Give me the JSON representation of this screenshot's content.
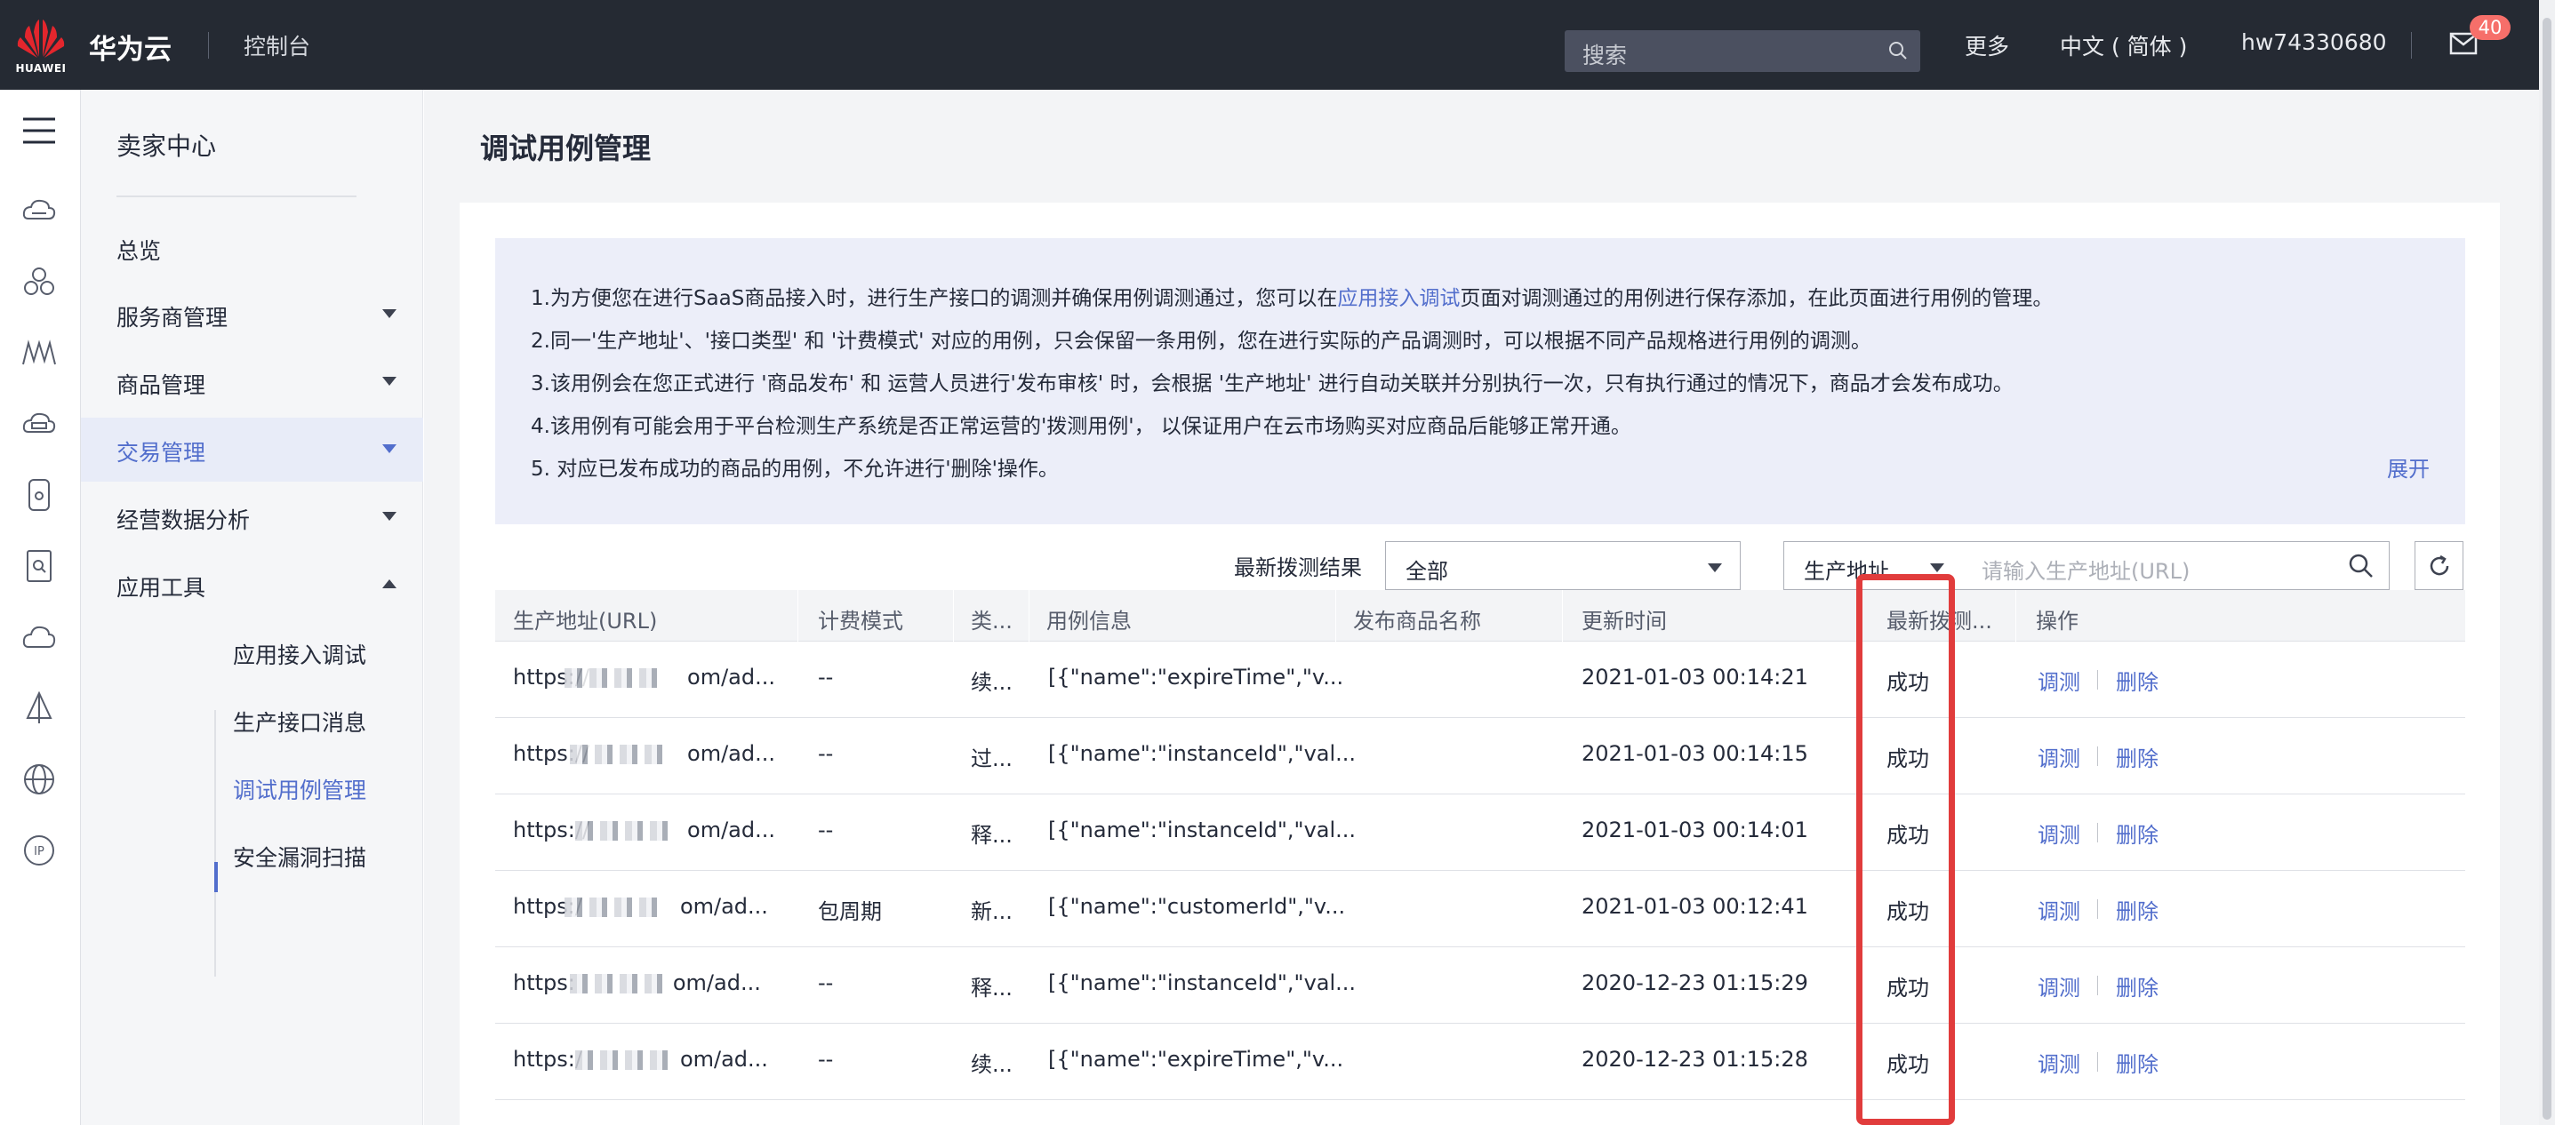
{
  "topbar": {
    "logo_text": "HUAWEI",
    "brand": "华为云",
    "console": "控制台",
    "search_placeholder": "搜索",
    "more": "更多",
    "language": "中文 ( 简体 )",
    "username": "hw74330680",
    "mail_badge": "40"
  },
  "rail": {
    "icons": [
      "menu-icon",
      "cloud-server-icon",
      "cluster-icon",
      "network-icon",
      "storage-icon",
      "mobile-icon",
      "document-search-icon",
      "cloud-icon",
      "sail-icon",
      "globe-icon",
      "ip-icon"
    ]
  },
  "sidemenu": {
    "title": "卖家中心",
    "items": [
      {
        "label": "总览"
      },
      {
        "label": "服务商管理"
      },
      {
        "label": "商品管理"
      },
      {
        "label": "交易管理"
      },
      {
        "label": "经营数据分析"
      },
      {
        "label": "应用工具"
      }
    ],
    "subitems": [
      {
        "label": "应用接入调试"
      },
      {
        "label": "生产接口消息"
      },
      {
        "label": "调试用例管理"
      },
      {
        "label": "安全漏洞扫描"
      }
    ]
  },
  "page": {
    "title": "调试用例管理",
    "notice": {
      "line1_pre": "1.为方便您在进行SaaS商品接入时，进行生产接口的调测并确保用例调测通过，您可以在",
      "line1_link": "应用接入调试",
      "line1_post": "页面对调测通过的用例进行保存添加，在此页面进行用例的管理。",
      "line2": "2.同一'生产地址'、'接口类型' 和 '计费模式' 对应的用例，只会保留一条用例，您在进行实际的产品调测时，可以根据不同产品规格进行用例的调测。",
      "line3": "3.该用例会在您正式进行 '商品发布' 和 运营人员进行'发布审核' 时，会根据 '生产地址' 进行自动关联并分别执行一次，只有执行通过的情况下，商品才会发布成功。",
      "line4": "4.该用例有可能会用于平台检测生产系统是否正常运营的'拨测用例'， 以保证用户在云市场购买对应商品后能够正常开通。",
      "line5": "5. 对应已发布成功的商品的用例，不允许进行'删除'操作。",
      "expand": "展开"
    },
    "filter": {
      "label": "最新拨测结果",
      "result_value": "全部",
      "field_value": "生产地址",
      "url_placeholder": "请输入生产地址(URL)"
    },
    "table": {
      "headers": [
        "生产地址(URL)",
        "计费模式",
        "类...",
        "用例信息",
        "发布商品名称",
        "更新时间",
        "最新拨测...",
        "操作"
      ],
      "rows": [
        {
          "url_start": "https://",
          "url_end": "om/ad...",
          "billing": "--",
          "type": "续...",
          "info": "[{\"name\":\"expireTime\",\"v...",
          "product": "",
          "time": "2021-01-03 00:14:21",
          "result": "成功",
          "debug": "调测",
          "delete": "删除"
        },
        {
          "url_start": "https://",
          "url_end": "om/ad...",
          "billing": "--",
          "type": "过...",
          "info": "[{\"name\":\"instanceId\",\"val...",
          "product": "",
          "time": "2021-01-03 00:14:15",
          "result": "成功",
          "debug": "调测",
          "delete": "删除"
        },
        {
          "url_start": "https://",
          "url_end": "om/ad...",
          "billing": "--",
          "type": "释...",
          "info": "[{\"name\":\"instanceId\",\"val...",
          "product": "",
          "time": "2021-01-03 00:14:01",
          "result": "成功",
          "debug": "调测",
          "delete": "删除"
        },
        {
          "url_start": "https:/",
          "url_end": "om/ad...",
          "billing": "包周期",
          "type": "新...",
          "info": "[{\"name\":\"customerId\",\"v...",
          "product": "",
          "time": "2021-01-03 00:12:41",
          "result": "成功",
          "debug": "调测",
          "delete": "删除"
        },
        {
          "url_start": "https:",
          "url_end": "om/ad...",
          "billing": "--",
          "type": "释...",
          "info": "[{\"name\":\"instanceId\",\"val...",
          "product": "",
          "time": "2020-12-23 01:15:29",
          "result": "成功",
          "debug": "调测",
          "delete": "删除"
        },
        {
          "url_start": "https:/",
          "url_end": "om/ad...",
          "billing": "--",
          "type": "续...",
          "info": "[{\"name\":\"expireTime\",\"v...",
          "product": "",
          "time": "2020-12-23 01:15:28",
          "result": "成功",
          "debug": "调测",
          "delete": "删除"
        }
      ]
    }
  },
  "colors": {
    "topbar": "#252a33",
    "accent": "#526ecc",
    "highlight": "#e13c3c",
    "badge": "#f66f6a"
  }
}
